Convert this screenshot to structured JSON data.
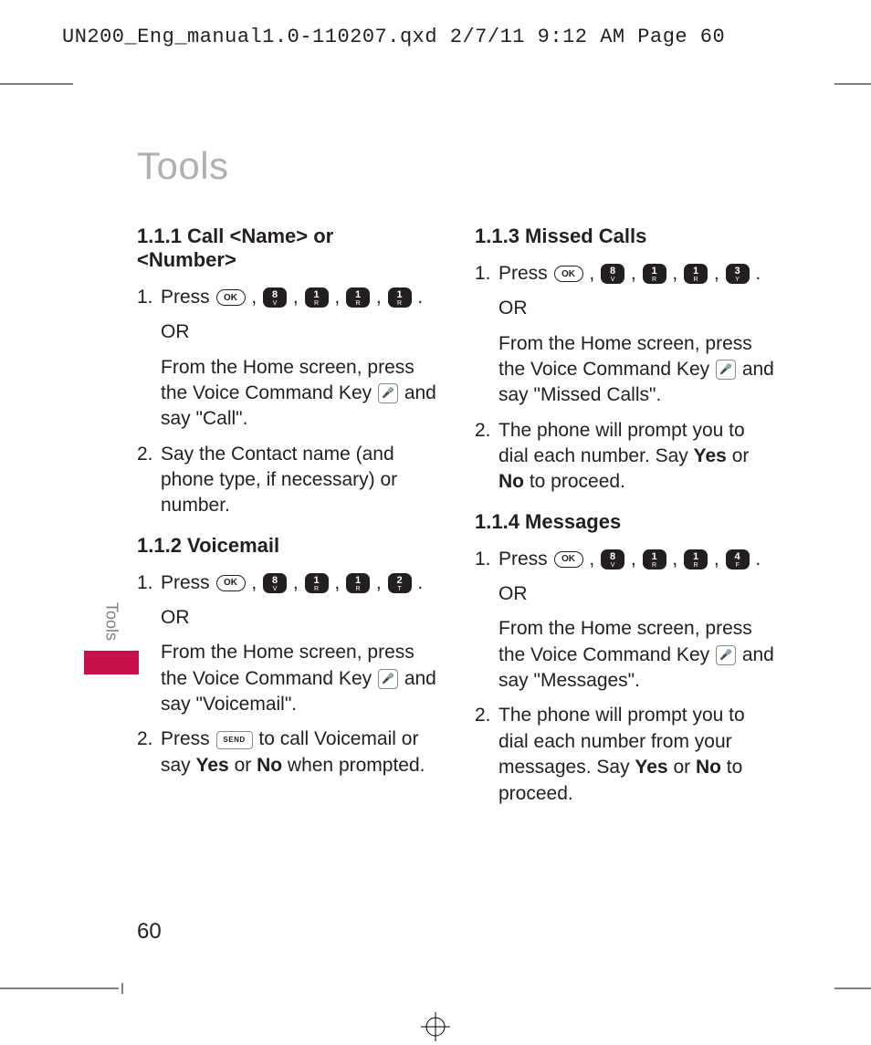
{
  "header": "UN200_Eng_manual1.0-110207.qxd  2/7/11  9:12 AM  Page 60",
  "title": "Tools",
  "side_tab": "Tools",
  "page_number": "60",
  "keys": {
    "ok": "OK",
    "send": "SEND",
    "voice": "🎤"
  },
  "left": {
    "s111": {
      "head": "1.1.1 Call <Name> or <Number>",
      "step1_a": "Press ",
      "seq": [
        [
          "8",
          "V"
        ],
        [
          "1",
          "R"
        ],
        [
          "1",
          "R"
        ],
        [
          "1",
          "R"
        ]
      ],
      "or": "OR",
      "step1_b1": "From the Home screen, press the Voice Command Key ",
      "step1_b2": " and say \"Call\".",
      "step2": "Say the Contact name (and phone type, if necessary) or number."
    },
    "s112": {
      "head": "1.1.2 Voicemail",
      "step1_a": "Press ",
      "seq": [
        [
          "8",
          "V"
        ],
        [
          "1",
          "R"
        ],
        [
          "1",
          "R"
        ],
        [
          "2",
          "T"
        ]
      ],
      "or": "OR",
      "step1_b1": "From the Home screen, press the Voice Command Key ",
      "step1_b2": " and say \"Voicemail\".",
      "step2_a": "Press ",
      "step2_b": " to call Voicemail or say ",
      "yes": "Yes",
      "or2": " or ",
      "no": "No",
      "step2_c": " when prompted."
    }
  },
  "right": {
    "s113": {
      "head": "1.1.3 Missed Calls",
      "step1_a": "Press ",
      "seq": [
        [
          "8",
          "V"
        ],
        [
          "1",
          "R"
        ],
        [
          "1",
          "R"
        ],
        [
          "3",
          "Y"
        ]
      ],
      "or": "OR",
      "step1_b1": "From the Home screen, press the Voice Command Key ",
      "step1_b2": " and say \"Missed Calls\".",
      "step2_a": "The phone will prompt you to dial each number. Say ",
      "yes": "Yes",
      "or2": " or ",
      "no": "No",
      "step2_b": " to proceed."
    },
    "s114": {
      "head": "1.1.4 Messages",
      "step1_a": "Press ",
      "seq": [
        [
          "8",
          "V"
        ],
        [
          "1",
          "R"
        ],
        [
          "1",
          "R"
        ],
        [
          "4",
          "F"
        ]
      ],
      "or": "OR",
      "step1_b1": "From the Home screen, press the Voice Command Key ",
      "step1_b2": " and say \"Messages\".",
      "step2_a": "The phone will prompt you to dial each number from your messages. Say ",
      "yes": "Yes",
      "or2": " or ",
      "no": "No",
      "step2_b": " to proceed."
    }
  }
}
